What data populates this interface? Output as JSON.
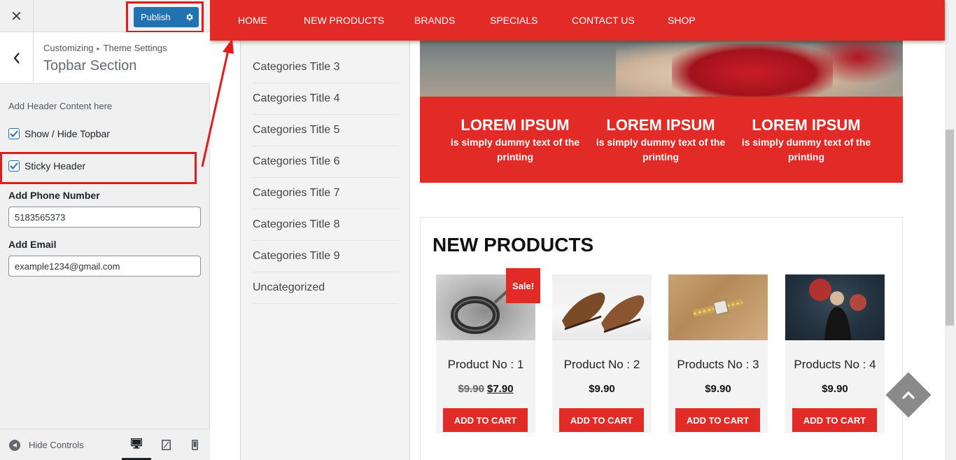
{
  "sidebar": {
    "publish_label": "Publish",
    "breadcrumb": {
      "parent": "Customizing",
      "child": "Theme Settings"
    },
    "section_title": "Topbar Section",
    "description": "Add Header Content here",
    "show_hide_topbar": {
      "label": "Show / Hide Topbar",
      "checked": true
    },
    "sticky_header": {
      "label": "Sticky Header",
      "checked": true
    },
    "phone": {
      "label": "Add Phone Number",
      "value": "5183565373"
    },
    "email": {
      "label": "Add Email",
      "value": "example1234@gmail.com"
    },
    "footer": {
      "hide_controls": "Hide Controls",
      "active_device": "desktop"
    }
  },
  "preview": {
    "nav": [
      "HOME",
      "NEW PRODUCTS",
      "BRANDS",
      "SPECIALS",
      "CONTACT US",
      "SHOP"
    ],
    "categories": [
      "Categories Title 3",
      "Categories Title 4",
      "Categories Title 5",
      "Categories Title 6",
      "Categories Title 7",
      "Categories Title 8",
      "Categories Title 9",
      "Uncategorized"
    ],
    "promo": [
      {
        "title": "LOREM IPSUM",
        "subtitle": "is simply dummy text of the printing"
      },
      {
        "title": "LOREM IPSUM",
        "subtitle": "is simply dummy text of the printing"
      },
      {
        "title": "LOREM IPSUM",
        "subtitle": "is simply dummy text of the printing"
      }
    ],
    "new_products_title": "NEW PRODUCTS",
    "products": [
      {
        "name": "Product No : 1",
        "old_price": "$9.90",
        "price": "$7.90",
        "sale_badge": "Sale!",
        "button": "ADD TO CART",
        "image": "ring-keychain"
      },
      {
        "name": "Product No : 2",
        "price": "$9.90",
        "button": "ADD TO CART",
        "image": "brown-shoes"
      },
      {
        "name": "Products No : 3",
        "price": "$9.90",
        "button": "ADD TO CART",
        "image": "wrist-watch"
      },
      {
        "name": "Products No : 4",
        "price": "$9.90",
        "button": "ADD TO CART",
        "image": "person-graffiti"
      }
    ]
  },
  "colors": {
    "accent_red": "#e22a27",
    "wp_blue": "#2271b1",
    "highlight_red": "#e21b1b"
  }
}
